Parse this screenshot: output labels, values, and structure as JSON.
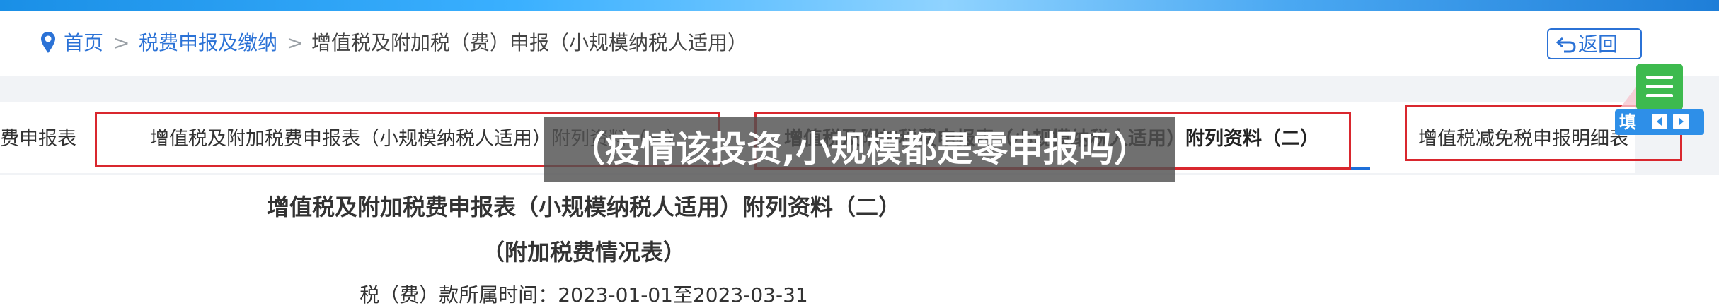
{
  "breadcrumb": {
    "home": "首页",
    "sep1": ">",
    "section": "税费申报及缴纳",
    "sep2": ">",
    "current": "增值税及附加税（费）申报（小规模纳税人适用）"
  },
  "header": {
    "back_label": "返回"
  },
  "tabs": [
    {
      "label": "费申报表"
    },
    {
      "label": "增值税及附加税费申报表（小规模纳税人适用）附列资料（一）"
    },
    {
      "label": "增值税及附加税费申报表（小规模纳税人适用）附列资料（二）"
    },
    {
      "label": "增值税减免税申报明细表"
    }
  ],
  "form": {
    "title": "增值税及附加税费申报表（小规模纳税人适用）附列资料（二）",
    "subtitle": "（附加税费情况表）",
    "period": "税（费）款所属时间：2023-01-01至2023-03-31"
  },
  "overlay_caption": "（疫情该投资,小规模都是零申报吗）",
  "float_widget": {
    "label": "填"
  },
  "colors": {
    "accent": "#2b72d6",
    "highlight": "#d9272e",
    "active_tab": "#1e6fd9",
    "menu_green": "#3dba4e"
  },
  "icons": [
    "location-pin-icon",
    "return-arrow-icon",
    "menu-icon",
    "prev-icon",
    "next-icon"
  ]
}
